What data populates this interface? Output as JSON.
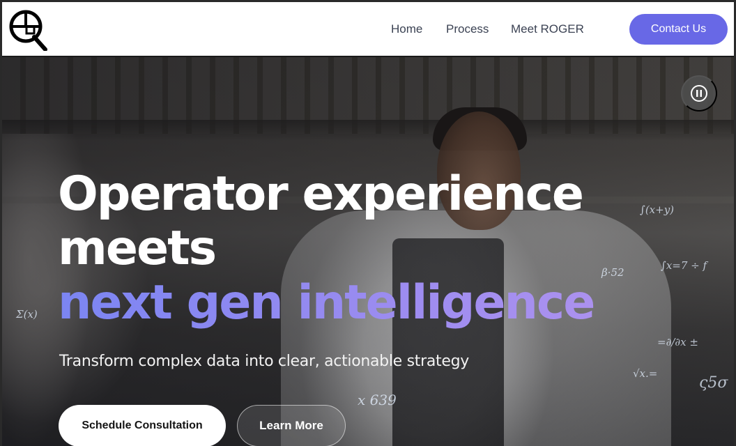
{
  "header": {
    "logo_icon": "q-magnifier-logo",
    "nav": {
      "home": "Home",
      "process": "Process",
      "meet_roger": "Meet ROGER"
    },
    "contact_label": "Contact Us"
  },
  "hero": {
    "headline_line1": "Operator experience",
    "headline_line2": "meets",
    "headline_line3": "next gen intelligence",
    "subheading": "Transform complex data into clear, actionable strategy",
    "primary_cta": "Schedule Consultation",
    "secondary_cta": "Learn More",
    "pause_icon": "pause-icon",
    "background_image": "chef-in-kitchen-with-math-formulas"
  },
  "colors": {
    "accent": "#6868e6",
    "headline_gradient_start": "#7b85f2",
    "headline_gradient_end": "#b294ee",
    "nav_text": "#3b4253"
  }
}
